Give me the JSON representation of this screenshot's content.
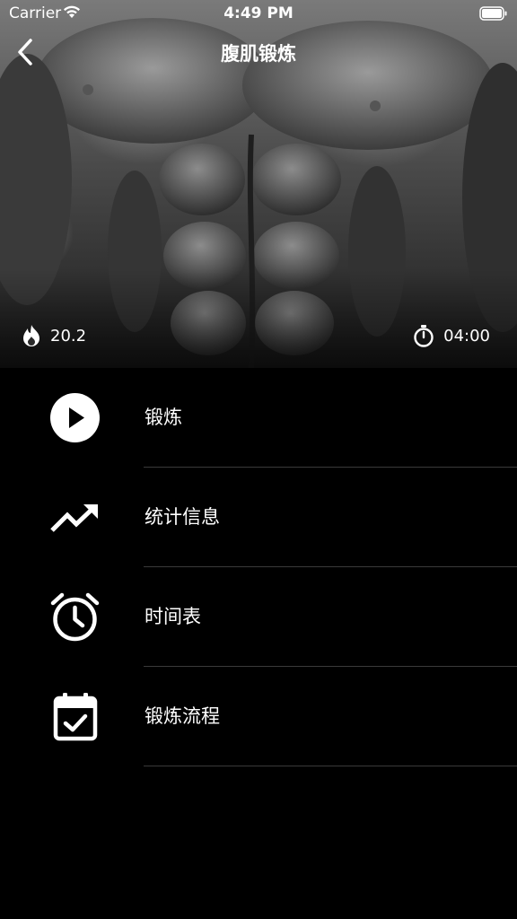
{
  "status_bar": {
    "carrier": "Carrier",
    "time": "4:49 PM"
  },
  "nav": {
    "title": "腹肌锻炼",
    "back_icon": "chevron-left-icon"
  },
  "hero": {
    "calories": "20.2",
    "calories_icon": "flame-icon",
    "duration": "04:00",
    "duration_icon": "stopwatch-icon"
  },
  "menu": {
    "items": [
      {
        "label": "锻炼",
        "icon": "play-circle-icon"
      },
      {
        "label": "统计信息",
        "icon": "trending-up-icon"
      },
      {
        "label": "时间表",
        "icon": "alarm-clock-icon"
      },
      {
        "label": "锻炼流程",
        "icon": "calendar-check-icon"
      }
    ]
  },
  "colors": {
    "background": "#000000",
    "text": "#ffffff",
    "divider": "#3a3a3a"
  }
}
